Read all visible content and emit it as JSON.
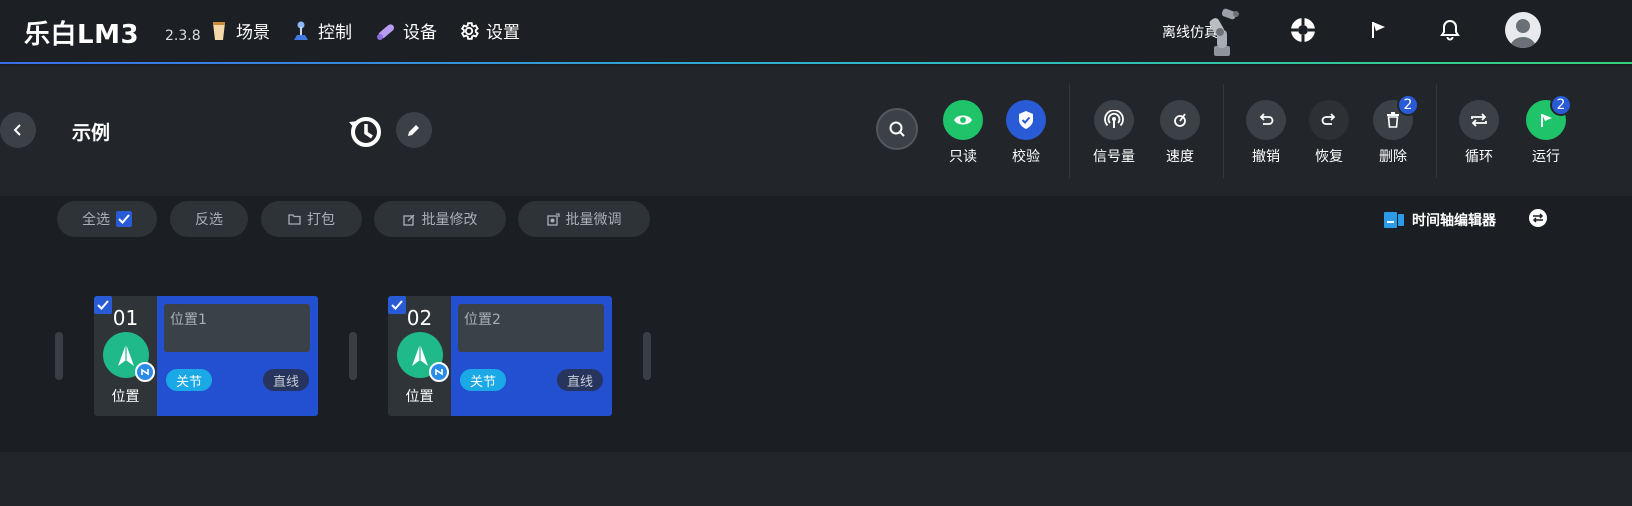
{
  "app": {
    "brand": "乐白LM3",
    "version": "2.3.8",
    "nav": [
      {
        "label": "场景",
        "icon": "cup-icon"
      },
      {
        "label": "控制",
        "icon": "joystick-icon"
      },
      {
        "label": "设备",
        "icon": "device-icon"
      },
      {
        "label": "设置",
        "icon": "gear-icon"
      }
    ],
    "offline_sim": "离线仿真"
  },
  "toolbar": {
    "title": "示例",
    "tools": [
      {
        "label": "只读",
        "icon": "eye-icon",
        "color": "#1fc46a"
      },
      {
        "label": "校验",
        "icon": "shield-icon",
        "color": "#2a5bd7"
      },
      {
        "label": "信号量",
        "icon": "signal-icon"
      },
      {
        "label": "速度",
        "icon": "speed-icon"
      },
      {
        "label": "撤销",
        "icon": "undo-icon"
      },
      {
        "label": "恢复",
        "icon": "redo-icon"
      },
      {
        "label": "删除",
        "icon": "trash-icon",
        "badge": "2"
      },
      {
        "label": "循环",
        "icon": "loop-icon"
      },
      {
        "label": "运行",
        "icon": "flag-icon",
        "color": "#1fc46a",
        "badge": "2"
      }
    ]
  },
  "actions": {
    "select_all": "全选",
    "invert": "反选",
    "pack": "打包",
    "batch_edit": "批量修改",
    "batch_tune": "批量微调",
    "timeline_editor": "时间轴编辑器"
  },
  "cards": [
    {
      "num": "01",
      "name": "位置1",
      "type_label": "位置",
      "joint": "关节",
      "motion": "直线"
    },
    {
      "num": "02",
      "name": "位置2",
      "type_label": "位置",
      "joint": "关节",
      "motion": "直线"
    }
  ]
}
